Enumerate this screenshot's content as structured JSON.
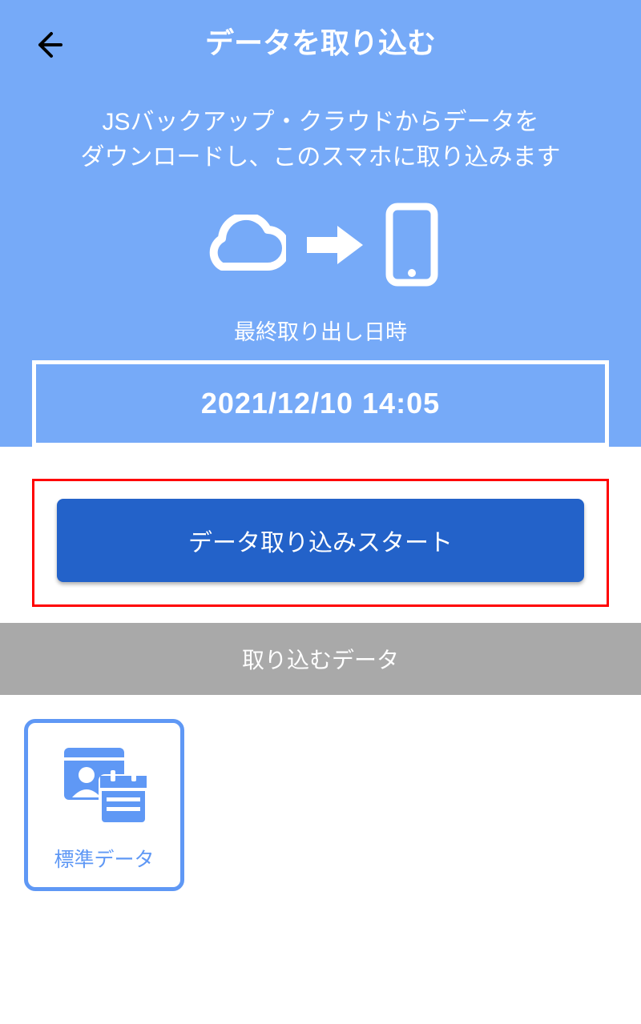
{
  "header": {
    "title": "データを取り込む"
  },
  "panel": {
    "subtitle_line1": "JSバックアップ・クラウドからデータを",
    "subtitle_line2": "ダウンロードし、このスマホに取り込みます",
    "last_export_label": "最終取り出し日時",
    "last_export_datetime": "2021/12/10 14:05"
  },
  "actions": {
    "start_label": "データ取り込みスタート"
  },
  "section": {
    "header_label": "取り込むデータ"
  },
  "options": [
    {
      "label": "標準データ"
    }
  ],
  "colors": {
    "blue_panel": "#76aaf8",
    "primary_button": "#2362c9",
    "accent": "#5f98f5",
    "section_bg": "#a9a9a9",
    "highlight": "#ff0000"
  }
}
